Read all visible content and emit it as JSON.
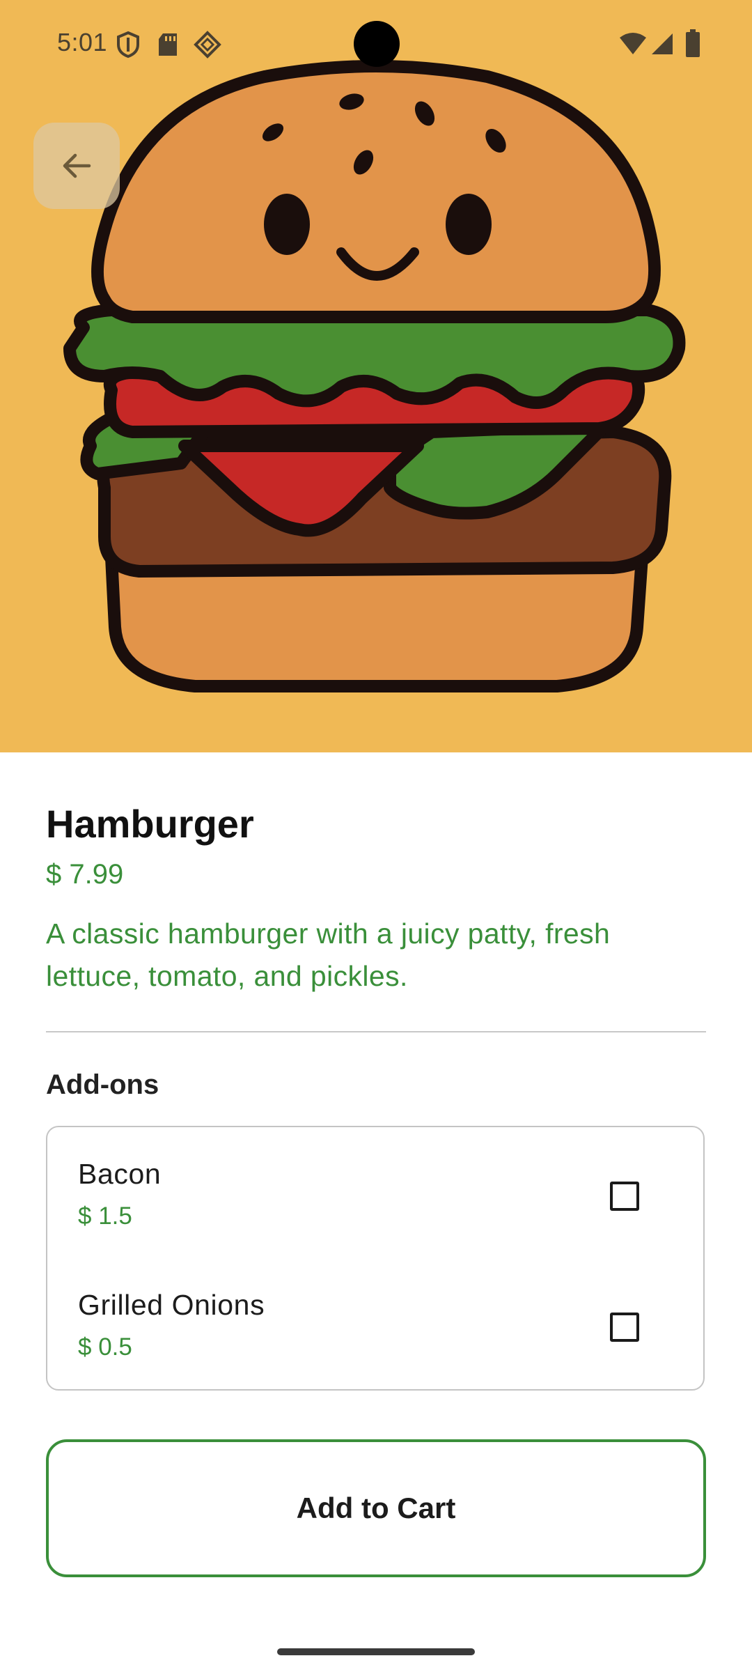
{
  "status_bar": {
    "time": "5:01",
    "left_icons": [
      "shield-icon",
      "sd-card-icon",
      "nearby-icon"
    ],
    "right_icons": [
      "wifi-icon",
      "cell-signal-icon",
      "battery-icon"
    ]
  },
  "hero": {
    "image": "hamburger-illustration",
    "background_color": "#f0b955"
  },
  "navigation": {
    "back_icon": "arrow-back-icon"
  },
  "product": {
    "title": "Hamburger",
    "price": "$ 7.99",
    "description": "A classic hamburger with a juicy patty, fresh lettuce, tomato, and pickles."
  },
  "addons": {
    "heading": "Add-ons",
    "items": [
      {
        "name": "Bacon",
        "price": "$ 1.5",
        "checked": false
      },
      {
        "name": "Grilled Onions",
        "price": "$ 0.5",
        "checked": false
      }
    ]
  },
  "actions": {
    "add_to_cart_label": "Add to Cart"
  },
  "colors": {
    "accent_green": "#3a8f3a",
    "hero_yellow": "#f0b955"
  }
}
